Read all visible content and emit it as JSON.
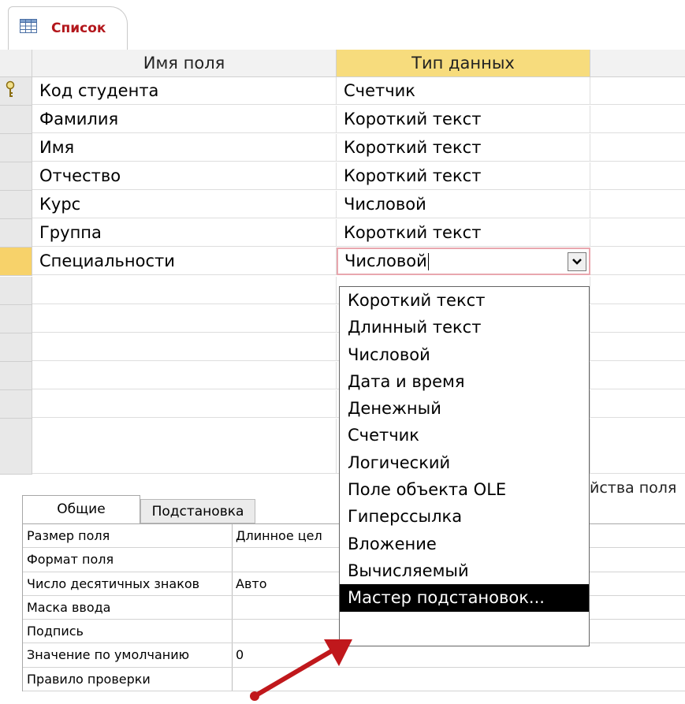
{
  "tab": {
    "title": "Список"
  },
  "grid": {
    "headers": {
      "field_name": "Имя поля",
      "data_type": "Тип данных"
    },
    "rows": [
      {
        "name": "Код студента",
        "type": "Счетчик",
        "primary_key": true
      },
      {
        "name": "Фамилия",
        "type": "Короткий текст"
      },
      {
        "name": "Имя",
        "type": "Короткий текст"
      },
      {
        "name": "Отчество",
        "type": "Короткий текст"
      },
      {
        "name": "Курс",
        "type": "Числовой"
      },
      {
        "name": "Группа",
        "type": "Короткий текст"
      }
    ],
    "current_row": {
      "name": "Специальности",
      "type": "Числовой"
    }
  },
  "dropdown": {
    "options": [
      "Короткий текст",
      "Длинный текст",
      "Числовой",
      "Дата и время",
      "Денежный",
      "Счетчик",
      "Логический",
      "Поле объекта OLE",
      "Гиперссылка",
      "Вложение",
      "Вычисляемый",
      "Мастер подстановок..."
    ],
    "highlighted": "Мастер подстановок..."
  },
  "field_properties": {
    "caption_fragment": "йства поля",
    "tabs": {
      "general": "Общие",
      "lookup": "Подстановка"
    },
    "rows": [
      {
        "label": "Размер поля",
        "value": "Длинное цел"
      },
      {
        "label": "Формат поля",
        "value": ""
      },
      {
        "label": "Число десятичных знаков",
        "value": "Авто"
      },
      {
        "label": "Маска ввода",
        "value": ""
      },
      {
        "label": "Подпись",
        "value": ""
      },
      {
        "label": "Значение по умолчанию",
        "value": "0"
      },
      {
        "label": "Правило проверки",
        "value": ""
      }
    ]
  },
  "colors": {
    "tab_title": "#b3171c",
    "selected_column": "#f7dc7d",
    "arrow": "#c0181c"
  }
}
